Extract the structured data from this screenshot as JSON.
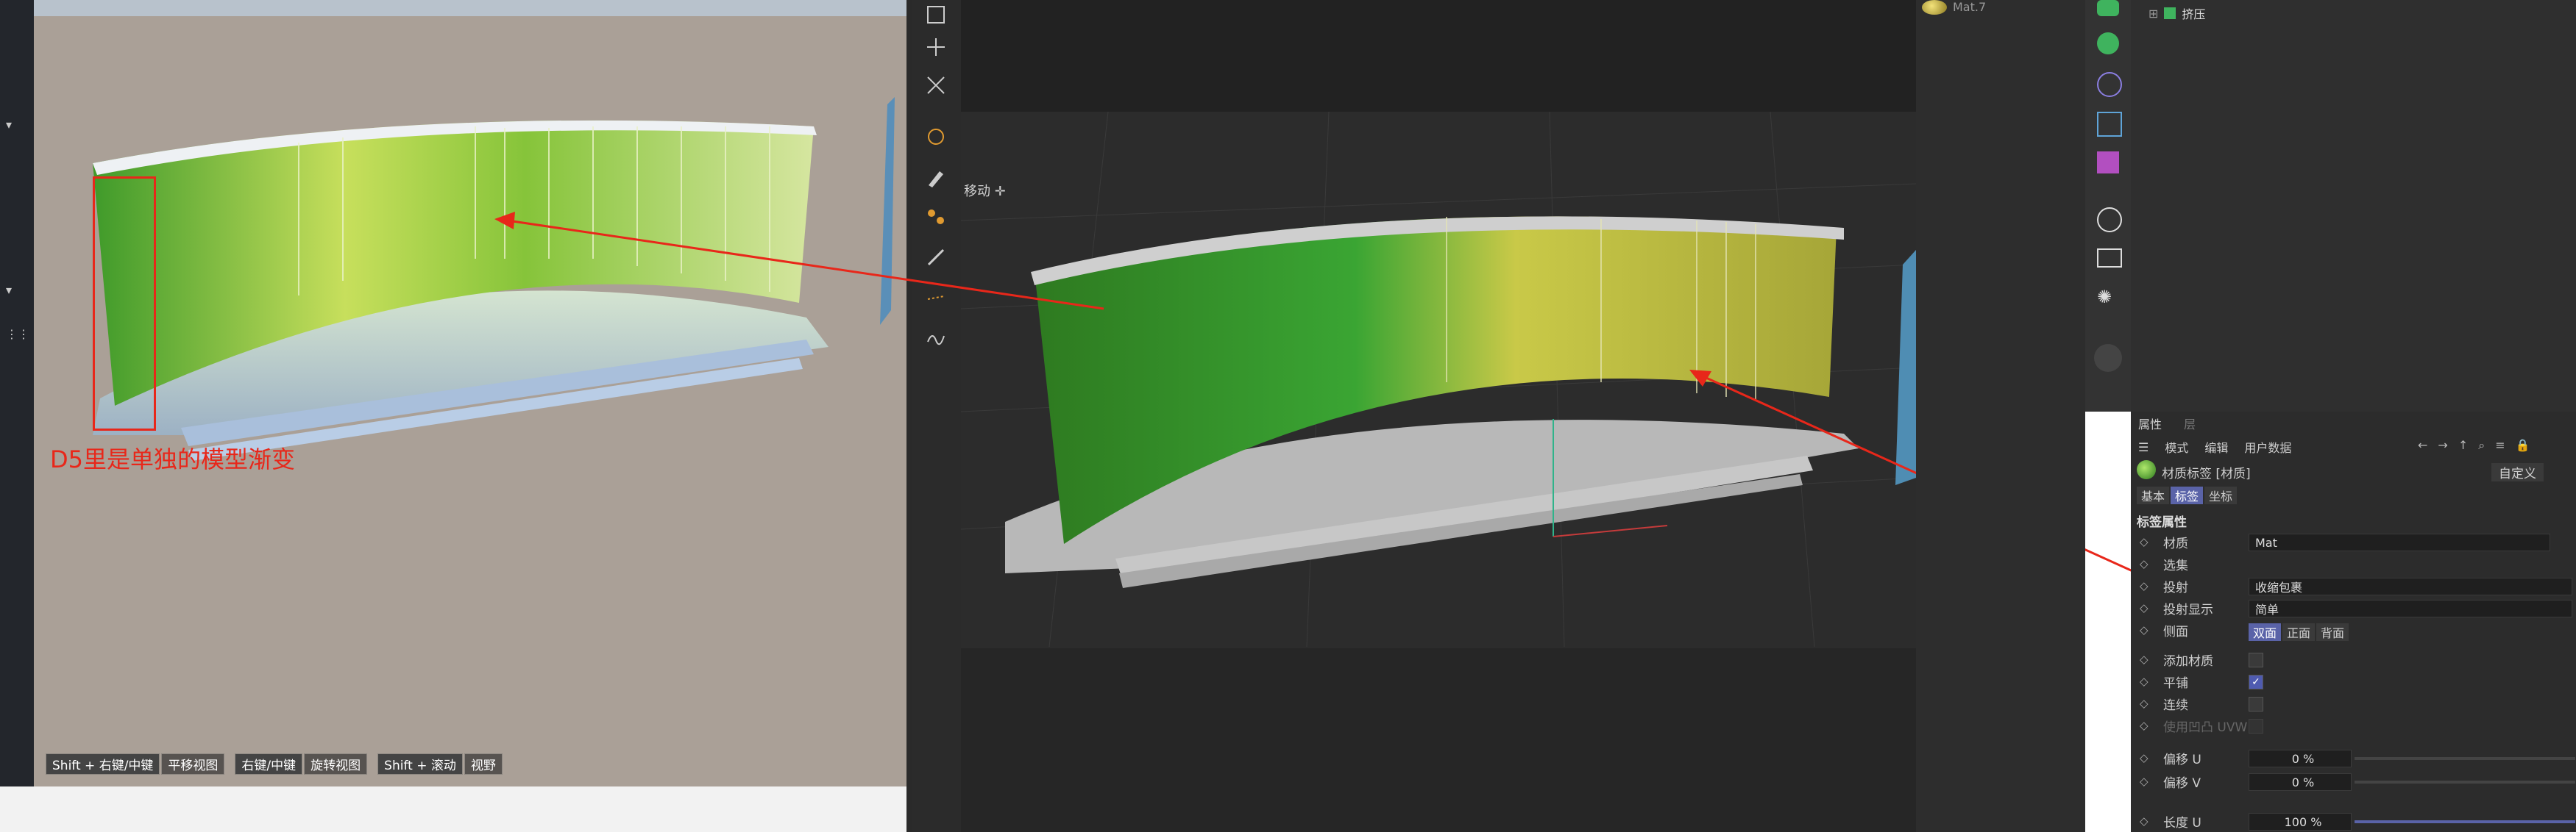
{
  "d5": {
    "caption": "D5里是单独的模型渐变",
    "tips": [
      {
        "key": "Shift + 右键/中键",
        "action": "平移视图"
      },
      {
        "key": "右键/中键",
        "action": "旋转视图"
      },
      {
        "key": "Shift + 滚动",
        "action": "视野"
      }
    ]
  },
  "viewport": {
    "label": "移动"
  },
  "material_manager": {
    "item": "Mat.7"
  },
  "object_manager": {
    "item": "挤压"
  },
  "attributes": {
    "tabs": [
      "属性",
      "层"
    ],
    "menu": [
      "模式",
      "编辑",
      "用户数据"
    ],
    "title": "材质标签 [材质]",
    "preset": "自定义",
    "subtabs": [
      "基本",
      "标签",
      "坐标"
    ],
    "section": "标签属性",
    "material_label": "材质",
    "material_value": "Mat",
    "selection_label": "选集",
    "projection_label": "投射",
    "projection_value": "收缩包裹",
    "projection_display_label": "投射显示",
    "projection_display_value": "简单",
    "side_label": "侧面",
    "side_options": [
      "双面",
      "正面",
      "背面"
    ],
    "add_material_label": "添加材质",
    "tile_label": "平铺",
    "seamless_label": "连续",
    "uvw_label": "使用凹凸 UVW",
    "offset_u_label": "偏移 U",
    "offset_u_value": "0 %",
    "offset_v_label": "偏移 V",
    "offset_v_value": "0 %",
    "length_u_label": "长度 U",
    "length_u_value": "100 %"
  },
  "colors": {
    "annotation_red": "#e8271a",
    "accent": "#5a63a8"
  }
}
